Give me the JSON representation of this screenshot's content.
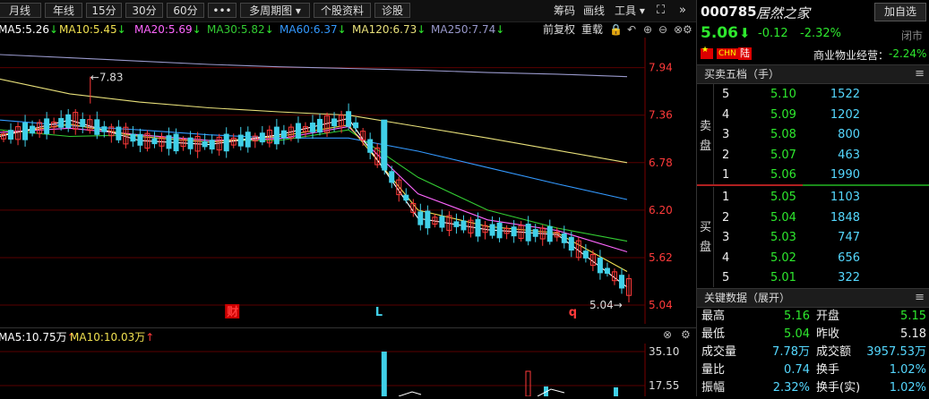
{
  "toolbar": {
    "buttons": [
      "月线",
      "年线",
      "15分",
      "30分",
      "60分",
      "•••",
      "多周期图 ▾",
      "个股资料",
      "诊股"
    ],
    "right_items": [
      "筹码",
      "画线",
      "工具 ▾"
    ]
  },
  "sub_toolbar": {
    "fq": "前复权",
    "overlay": "重载"
  },
  "ma": {
    "ma5": "MA5:5.26",
    "ma10": "MA10:5.45",
    "ma20": "MA20:5.69",
    "ma30": "MA30:5.82",
    "ma60": "MA60:6.37",
    "ma120": "MA120:6.73",
    "ma250": "MA250:7.74",
    "arrow": "↓"
  },
  "colors": {
    "ma5": "#ffffff",
    "ma10": "#f0e050",
    "ma20": "#ff66ff",
    "ma30": "#33cc33",
    "ma60": "#3399ff",
    "ma120": "#e8e07a",
    "ma250": "#9999cc",
    "up": "#ff3a3a",
    "down": "#40d0e8",
    "grid": "#5a0000",
    "axis_text": "#ff3a3a"
  },
  "chart_data": {
    "type": "candlestick",
    "y_ticks": [
      7.94,
      7.36,
      6.78,
      6.2,
      5.62,
      5.04
    ],
    "ylim": [
      4.92,
      8.22
    ],
    "high_label": "←7.83",
    "high_value": 7.83,
    "low_label": "5.04→",
    "low_value": 5.04,
    "markers": [
      {
        "text": "财",
        "pos": 0.36
      },
      {
        "text": "L",
        "pos": 0.59
      },
      {
        "text": "q",
        "pos": 0.89
      }
    ],
    "ma250": [
      8.1,
      8.06,
      8.02,
      7.98,
      7.95,
      7.93,
      7.91,
      7.88,
      7.86,
      7.83
    ],
    "ma120": [
      7.8,
      7.62,
      7.52,
      7.45,
      7.4,
      7.36,
      7.22,
      7.08,
      6.93,
      6.78
    ],
    "ma60": [
      7.3,
      7.23,
      7.18,
      7.12,
      7.08,
      7.08,
      6.92,
      6.72,
      6.52,
      6.33
    ],
    "ma30": [
      7.18,
      7.1,
      7.12,
      7.05,
      7.05,
      7.18,
      6.6,
      6.2,
      5.98,
      5.82
    ],
    "ma20": [
      7.15,
      7.2,
      7.12,
      7.05,
      7.07,
      7.22,
      6.4,
      6.08,
      5.95,
      5.69
    ],
    "ma10": [
      7.12,
      7.25,
      7.1,
      7.03,
      7.1,
      7.24,
      6.2,
      6.0,
      5.92,
      5.45
    ],
    "ma5": [
      7.1,
      7.3,
      7.05,
      7.0,
      7.12,
      7.32,
      6.1,
      5.96,
      5.9,
      5.26
    ]
  },
  "volume": {
    "ma5": "MA5:10.75万",
    "ma10": "MA10:10.03万",
    "arrow": "↑",
    "ticks": [
      "35.10",
      "17.55"
    ]
  },
  "stock": {
    "code": "000785",
    "name": "居然之家",
    "fav": "加自选",
    "price": "5.06",
    "arrow": "⬇",
    "change": "-0.12",
    "pct": "-2.32%",
    "status": "闭市",
    "tag_cn": "CHN",
    "tag_lu": "陆",
    "sector_label": "商业物业经营：",
    "sector_pct": "-2.24%"
  },
  "orderbook": {
    "title": "买卖五档（手）",
    "sell_label": [
      "卖",
      "盘"
    ],
    "buy_label": [
      "买",
      "盘"
    ],
    "sell": [
      {
        "n": "5",
        "p": "5.10",
        "v": "1522"
      },
      {
        "n": "4",
        "p": "5.09",
        "v": "1202"
      },
      {
        "n": "3",
        "p": "5.08",
        "v": "800"
      },
      {
        "n": "2",
        "p": "5.07",
        "v": "463"
      },
      {
        "n": "1",
        "p": "5.06",
        "v": "1990"
      }
    ],
    "buy": [
      {
        "n": "1",
        "p": "5.05",
        "v": "1103"
      },
      {
        "n": "2",
        "p": "5.04",
        "v": "1848"
      },
      {
        "n": "3",
        "p": "5.03",
        "v": "747"
      },
      {
        "n": "4",
        "p": "5.02",
        "v": "656"
      },
      {
        "n": "5",
        "p": "5.01",
        "v": "322"
      }
    ]
  },
  "keydata": {
    "title": "关键数据（展开）",
    "rows": [
      {
        "l1": "最高",
        "v1": "5.16",
        "l2": "开盘",
        "v2": "5.15"
      },
      {
        "l1": "最低",
        "v1": "5.04",
        "l2": "昨收",
        "v2": "5.18"
      },
      {
        "l1": "成交量",
        "v1": "7.78万",
        "l2": "成交额",
        "v2": "3957.53万"
      },
      {
        "l1": "量比",
        "v1": "0.74",
        "l2": "换手",
        "v2": "1.02%"
      },
      {
        "l1": "振幅",
        "v1": "2.32%",
        "l2": "换手(实)",
        "v2": "1.02%"
      }
    ]
  }
}
